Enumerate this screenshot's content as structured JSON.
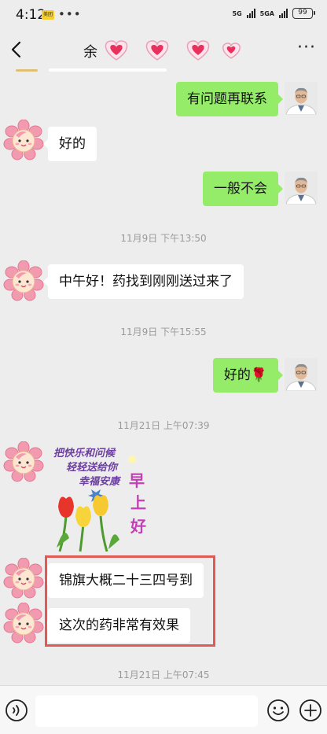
{
  "status_bar": {
    "time": "4:12",
    "app_badge": "美团",
    "dots": "•••",
    "network_1": "5G",
    "network_2": "5GA",
    "battery": "99"
  },
  "header": {
    "back_icon": "chevron-left-icon",
    "title": "余",
    "title_decoration": "heart-stickers",
    "more_icon": "more-dots-icon",
    "more": "···"
  },
  "messages": [
    {
      "side": "me",
      "text": "有问题再联系"
    },
    {
      "side": "them",
      "text": "好的"
    },
    {
      "side": "me",
      "text": "一般不会"
    },
    {
      "type": "time",
      "text": "11月9日 下午13:50"
    },
    {
      "side": "them",
      "text": "中午好！药找到刚刚送过来了"
    },
    {
      "type": "time",
      "text": "11月9日 下午15:55"
    },
    {
      "side": "me",
      "text": "好的🌹"
    },
    {
      "type": "time",
      "text": "11月21日 上午07:39"
    },
    {
      "side": "them",
      "type": "sticker",
      "sticker_text": [
        "把快乐和问候",
        "轻轻送给你",
        "幸福安康",
        "早",
        "上",
        "好"
      ]
    },
    {
      "side": "them",
      "text": "锦旗大概二十三四号到"
    },
    {
      "side": "them",
      "text": "这次的药非常有效果"
    },
    {
      "type": "time",
      "text": "11月21日 上午07:45"
    }
  ],
  "input_bar": {
    "voice_icon": "voice-icon",
    "placeholder": "",
    "emoji_icon": "emoji-icon",
    "plus_icon": "plus-icon"
  },
  "colors": {
    "my_bubble": "#95ec69",
    "their_bubble": "#ffffff",
    "background": "#ededed",
    "highlight": "#e05a55"
  }
}
